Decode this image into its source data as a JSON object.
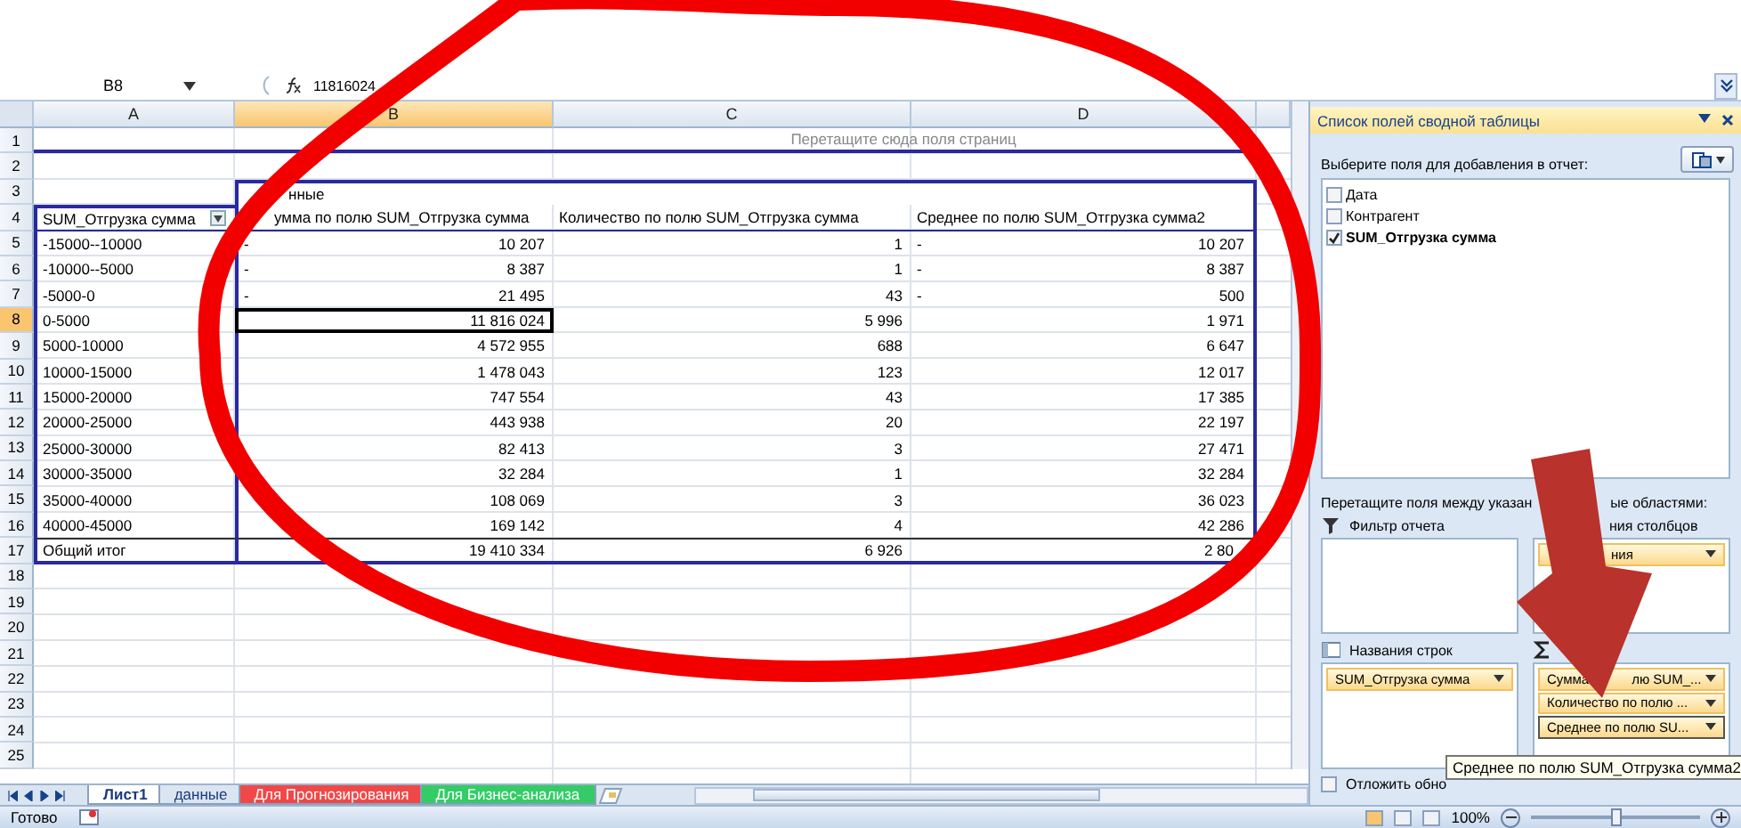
{
  "formula_bar": {
    "cell": "B8",
    "value": "11816024"
  },
  "columns": [
    {
      "label": "A",
      "selected": false
    },
    {
      "label": "B",
      "selected": true
    },
    {
      "label": "C",
      "selected": false
    },
    {
      "label": "D",
      "selected": false
    }
  ],
  "row_headers": [
    {
      "label": "1",
      "selected": false
    },
    {
      "label": "2",
      "selected": false
    },
    {
      "label": "3",
      "selected": false
    },
    {
      "label": "4",
      "selected": false
    },
    {
      "label": "5",
      "selected": false
    },
    {
      "label": "6",
      "selected": false
    },
    {
      "label": "7",
      "selected": false
    },
    {
      "label": "8",
      "selected": true
    },
    {
      "label": "9",
      "selected": false
    },
    {
      "label": "10",
      "selected": false
    },
    {
      "label": "11",
      "selected": false
    },
    {
      "label": "12",
      "selected": false
    },
    {
      "label": "13",
      "selected": false
    },
    {
      "label": "14",
      "selected": false
    },
    {
      "label": "15",
      "selected": false
    },
    {
      "label": "16",
      "selected": false
    },
    {
      "label": "17",
      "selected": false
    },
    {
      "label": "18",
      "selected": false
    },
    {
      "label": "19",
      "selected": false
    },
    {
      "label": "20",
      "selected": false
    },
    {
      "label": "21",
      "selected": false
    },
    {
      "label": "22",
      "selected": false
    },
    {
      "label": "23",
      "selected": false
    },
    {
      "label": "24",
      "selected": false
    },
    {
      "label": "25",
      "selected": false
    }
  ],
  "pivot": {
    "page_hint": "Перетащите сюда поля страниц",
    "data_label": "нные",
    "headers": [
      "SUM_Отгрузка сумма",
      "умма по полю SUM_Отгрузка сумма",
      "Количество по полю SUM_Отгрузка сумма",
      "Среднее по полю SUM_Отгрузка сумма2"
    ],
    "rows": [
      {
        "label": "-15000--10000",
        "cells": [
          {
            "marker": "-",
            "value": "10 207",
            "active": false
          },
          {
            "value": "1",
            "active": false
          },
          {
            "marker": "-",
            "value": "10 207",
            "active": false
          }
        ]
      },
      {
        "label": "-10000--5000",
        "cells": [
          {
            "marker": "-",
            "value": "8 387",
            "active": false
          },
          {
            "value": "1",
            "active": false
          },
          {
            "marker": "-",
            "value": "8 387",
            "active": false
          }
        ]
      },
      {
        "label": "-5000-0",
        "cells": [
          {
            "marker": "-",
            "value": "21 495",
            "active": false
          },
          {
            "value": "43",
            "active": false
          },
          {
            "marker": "-",
            "value": "500",
            "active": false
          }
        ]
      },
      {
        "label": "0-5000",
        "cells": [
          {
            "value": "11 816 024",
            "active": true
          },
          {
            "value": "5 996",
            "active": false
          },
          {
            "value": "1 971",
            "active": false
          }
        ]
      },
      {
        "label": "5000-10000",
        "cells": [
          {
            "value": "4 572 955",
            "active": false
          },
          {
            "value": "688",
            "active": false
          },
          {
            "value": "6 647",
            "active": false
          }
        ]
      },
      {
        "label": "10000-15000",
        "cells": [
          {
            "value": "1 478 043",
            "active": false
          },
          {
            "value": "123",
            "active": false
          },
          {
            "value": "12 017",
            "active": false
          }
        ]
      },
      {
        "label": "15000-20000",
        "cells": [
          {
            "value": "747 554",
            "active": false
          },
          {
            "value": "43",
            "active": false
          },
          {
            "value": "17 385",
            "active": false
          }
        ]
      },
      {
        "label": "20000-25000",
        "cells": [
          {
            "value": "443 938",
            "active": false
          },
          {
            "value": "20",
            "active": false
          },
          {
            "value": "22 197",
            "active": false
          }
        ]
      },
      {
        "label": "25000-30000",
        "cells": [
          {
            "value": "82 413",
            "active": false
          },
          {
            "value": "3",
            "active": false
          },
          {
            "value": "27 471",
            "active": false
          }
        ]
      },
      {
        "label": "30000-35000",
        "cells": [
          {
            "value": "32 284",
            "active": false
          },
          {
            "value": "1",
            "active": false
          },
          {
            "value": "32 284",
            "active": false
          }
        ]
      },
      {
        "label": "35000-40000",
        "cells": [
          {
            "value": "108 069",
            "active": false
          },
          {
            "value": "3",
            "active": false
          },
          {
            "value": "36 023",
            "active": false
          }
        ]
      },
      {
        "label": "40000-45000",
        "cells": [
          {
            "value": "169 142",
            "active": false
          },
          {
            "value": "4",
            "active": false
          },
          {
            "value": "42 286",
            "active": false
          }
        ]
      }
    ],
    "total": {
      "label": "Общий итог",
      "cells": [
        "19 410 334",
        "6 926",
        "2 80"
      ]
    }
  },
  "sheet_tabs": [
    {
      "label": "Лист1",
      "selected": true,
      "color": "#ffffff"
    },
    {
      "label": "данные",
      "selected": false,
      "color": "#dbe5f1"
    },
    {
      "label": "Для Прогнозирования",
      "selected": false,
      "color": "#f04848"
    },
    {
      "label": "Для Бизнес-анализа",
      "selected": false,
      "color": "#33cc66"
    }
  ],
  "status_bar": {
    "text": "Готово",
    "zoom": "100%",
    "zoom_level": {
      "level": 0.5
    }
  },
  "field_list": {
    "title": "Список полей сводной таблицы",
    "prompt": "Выберите поля для добавления в отчет:",
    "fields": [
      {
        "label": "Дата",
        "checked": false
      },
      {
        "label": "Контрагент",
        "checked": false
      },
      {
        "label": "SUM_Отгрузка сумма",
        "checked": true
      }
    ],
    "areas_hint": [
      "Перетащите поля между указан",
      "ые областями:"
    ],
    "areas": [
      {
        "kind": "filter",
        "label": "Фильтр отчета"
      },
      {
        "kind": "columns",
        "label": "ния столбцов",
        "items": [
          {
            "parts": [
              "ния"
            ],
            "selected": false
          }
        ]
      },
      {
        "kind": "rows",
        "label": "Названия строк",
        "items": [
          {
            "parts": [
              "SUM_Отгрузка сумма"
            ],
            "selected": false
          }
        ]
      },
      {
        "kind": "values",
        "items": [
          {
            "parts": [
              "Сумма",
              "лю SUM_..."
            ],
            "selected": false
          },
          {
            "parts": [
              "Количество по полю ..."
            ],
            "selected": false
          },
          {
            "parts": [
              "Среднее по полю SU..."
            ],
            "selected": true
          }
        ]
      }
    ],
    "defer": {
      "label": "Отложить обно",
      "checked": false
    },
    "tooltip": "Среднее по полю SUM_Отгрузка сумма2"
  },
  "annotations": [
    {
      "kind": "ellipse"
    },
    {
      "kind": "arrow"
    }
  ]
}
